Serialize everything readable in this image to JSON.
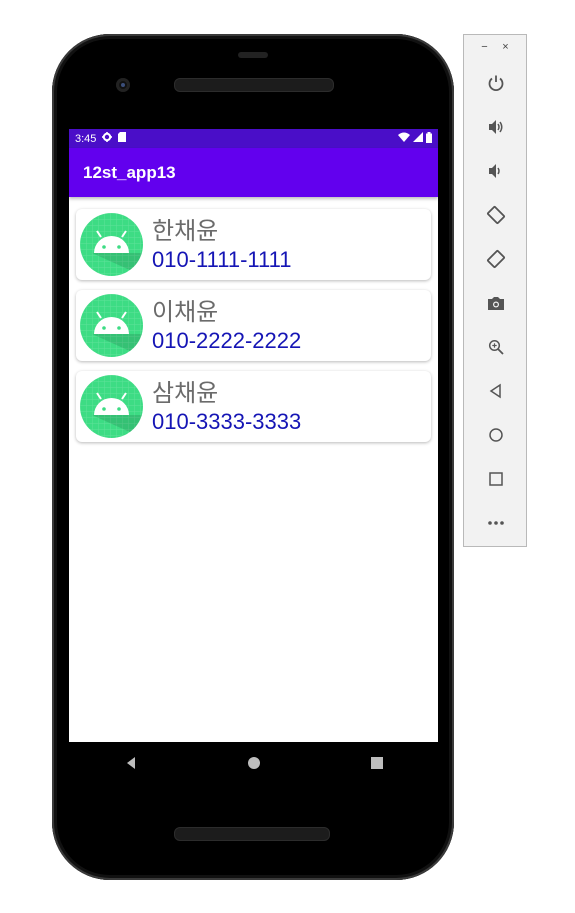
{
  "status_bar": {
    "time": "3:45",
    "icons": [
      "gear-icon",
      "sd-card-icon",
      "wifi-icon",
      "signal-icon",
      "battery-icon"
    ]
  },
  "app_bar": {
    "title": "12st_app13"
  },
  "contacts": [
    {
      "name": "한채윤",
      "phone": "010-1111-1111"
    },
    {
      "name": "이채윤",
      "phone": "010-2222-2222"
    },
    {
      "name": "삼채윤",
      "phone": "010-3333-3333"
    }
  ],
  "nav_bar": {
    "icons": [
      "back-icon",
      "home-icon",
      "recents-icon"
    ]
  },
  "emulator_panel": {
    "window_controls": {
      "minimize": "−",
      "close": "×"
    },
    "buttons": [
      "power-icon",
      "volume-up-icon",
      "volume-down-icon",
      "rotate-left-icon",
      "rotate-right-icon",
      "camera-icon",
      "zoom-icon",
      "back-icon",
      "home-icon",
      "overview-icon",
      "more-icon"
    ]
  },
  "colors": {
    "status_bar": "#4a0ec8",
    "app_bar": "#6200ee",
    "avatar_bg": "#3ddc84",
    "name_text": "#6b6b6b",
    "phone_text": "#1515b5"
  }
}
